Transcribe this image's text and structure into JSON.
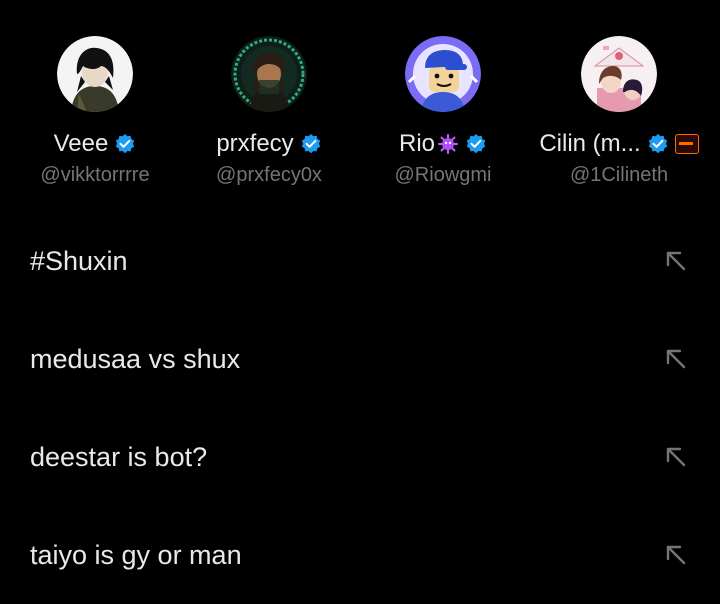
{
  "accounts": [
    {
      "name": "Veee",
      "handle": "@vikktorrrre"
    },
    {
      "name": "prxfecy",
      "handle": "@prxfecy0x"
    },
    {
      "name": "Rio",
      "handle": "@Riowgmi"
    },
    {
      "name": "Cilin (m...",
      "handle": "@1Cilineth"
    }
  ],
  "searches": [
    {
      "text": "#Shuxin"
    },
    {
      "text": "medusaa vs shux"
    },
    {
      "text": "deestar is bot?"
    },
    {
      "text": "taiyo is gy or man"
    }
  ],
  "colors": {
    "background": "#000000",
    "text_primary": "#e7e9ea",
    "text_secondary": "#71767b",
    "verified": "#1d9bf0"
  }
}
